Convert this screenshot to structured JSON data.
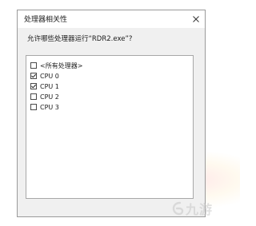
{
  "dialog": {
    "title": "处理器相关性",
    "prompt": "允许哪些处理器运行“RDR2.exe”?",
    "close_icon": "close-icon"
  },
  "processors": [
    {
      "label": "<所有处理器>",
      "checked": false
    },
    {
      "label": "CPU 0",
      "checked": true
    },
    {
      "label": "CPU 1",
      "checked": true
    },
    {
      "label": "CPU 2",
      "checked": false
    },
    {
      "label": "CPU 3",
      "checked": false
    }
  ],
  "watermark": {
    "text": "九游",
    "icon": "jiuyou-logo-icon"
  }
}
